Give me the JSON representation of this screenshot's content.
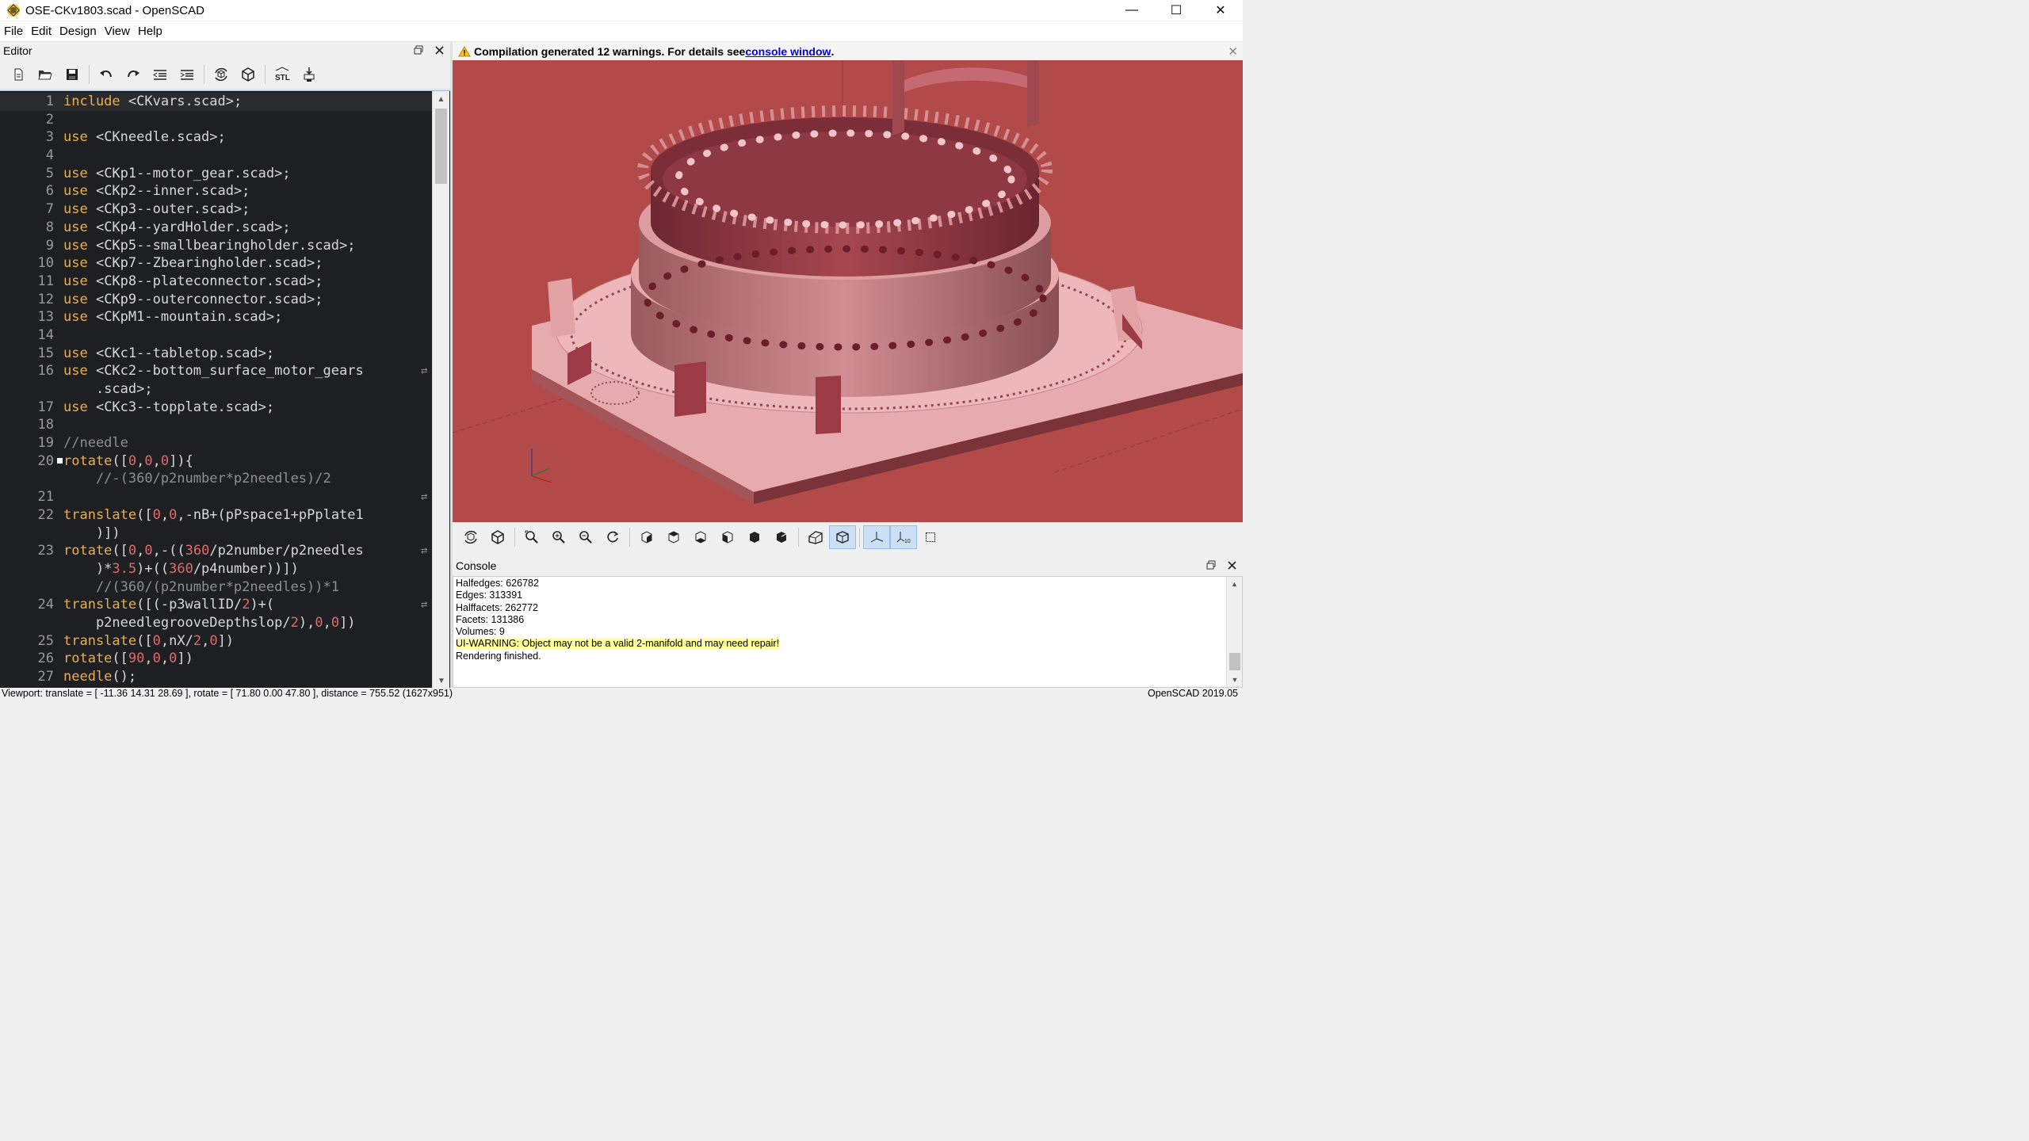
{
  "window": {
    "title": "OSE-CKv1803.scad - OpenSCAD",
    "minimize": "—",
    "maximize": "☐",
    "close": "✕"
  },
  "menu": [
    "File",
    "Edit",
    "Design",
    "View",
    "Help"
  ],
  "editor": {
    "title": "Editor",
    "toolbar": [
      "new-icon",
      "open-icon",
      "save-icon",
      "undo-icon",
      "redo-icon",
      "unindent-icon",
      "indent-icon",
      "preview-icon",
      "render-icon",
      "export-stl-icon",
      "send-to-print-icon"
    ],
    "stl_label": "STL",
    "lines": [
      {
        "n": "1",
        "t": "include <CKvars.scad>;"
      },
      {
        "n": "2",
        "t": ""
      },
      {
        "n": "3",
        "t": "use <CKneedle.scad>;"
      },
      {
        "n": "4",
        "t": ""
      },
      {
        "n": "5",
        "t": "use <CKp1--motor_gear.scad>;"
      },
      {
        "n": "6",
        "t": "use <CKp2--inner.scad>;"
      },
      {
        "n": "7",
        "t": "use <CKp3--outer.scad>;"
      },
      {
        "n": "8",
        "t": "use <CKp4--yardHolder.scad>;"
      },
      {
        "n": "9",
        "t": "use <CKp5--smallbearingholder.scad>;"
      },
      {
        "n": "10",
        "t": "use <CKp7--Zbearingholder.scad>;"
      },
      {
        "n": "11",
        "t": "use <CKp8--plateconnector.scad>;"
      },
      {
        "n": "12",
        "t": "use <CKp9--outerconnector.scad>;"
      },
      {
        "n": "13",
        "t": "use <CKpM1--mountain.scad>;"
      },
      {
        "n": "14",
        "t": ""
      },
      {
        "n": "15",
        "t": "use <CKc1--tabletop.scad>;"
      },
      {
        "n": "16",
        "t": "use <CKc2--bottom_surface_motor_gears"
      },
      {
        "n": "",
        "t": "    .scad>;"
      },
      {
        "n": "17",
        "t": "use <CKc3--topplate.scad>;"
      },
      {
        "n": "18",
        "t": ""
      },
      {
        "n": "19",
        "t": "//needle"
      },
      {
        "n": "20",
        "t": "rotate([0,0,0]){"
      },
      {
        "n": "",
        "t": "    //-(360/p2number*p2needles)/2"
      },
      {
        "n": "21",
        "t": ""
      },
      {
        "n": "22",
        "t": "translate([0,0,-nB+(pPspace1+pPplate1"
      },
      {
        "n": "",
        "t": "    )])"
      },
      {
        "n": "23",
        "t": "rotate([0,0,-((360/p2number/p2needles"
      },
      {
        "n": "",
        "t": "    )*3.5)+((360/p4number))])"
      },
      {
        "n": "",
        "t": "    //(360/(p2number*p2needles))*1"
      },
      {
        "n": "24",
        "t": "translate([(-p3wallID/2)+("
      },
      {
        "n": "",
        "t": "    p2needlegrooveDepthslop/2),0,0])"
      },
      {
        "n": "25",
        "t": "translate([0,nX/2,0])"
      },
      {
        "n": "26",
        "t": "rotate([90,0,0])"
      },
      {
        "n": "27",
        "t": "needle();"
      }
    ]
  },
  "warning": {
    "prefix": "Compilation generated 12 warnings. For details see ",
    "link": "console window",
    "suffix": "."
  },
  "viewer": {
    "background": "#b24a4a",
    "toolbar": [
      "preview-icon",
      "render-icon",
      "view-all-icon",
      "zoom-in-icon",
      "zoom-out-icon",
      "reset-view-icon",
      "view-right-icon",
      "view-top-icon",
      "view-bottom-icon",
      "view-left-icon",
      "view-front-icon",
      "view-back-icon",
      "perspective-icon",
      "orthogonal-icon",
      "show-axes-icon",
      "show-scale-markers-icon",
      "show-edges-icon"
    ]
  },
  "console": {
    "title": "Console",
    "lines": [
      "Halfedges: 626782",
      "Edges: 313391",
      "Halffacets: 262772",
      "Facets: 131386",
      "Volumes: 9",
      "UI-WARNING: Object may not be a valid 2-manifold and may need repair!",
      "Rendering finished."
    ]
  },
  "status": {
    "viewport": "Viewport: translate = [ -11.36 14.31 28.69 ], rotate = [ 71.80 0.00 47.80 ], distance = 755.52 (1627x951)",
    "version": "OpenSCAD 2019.05"
  }
}
